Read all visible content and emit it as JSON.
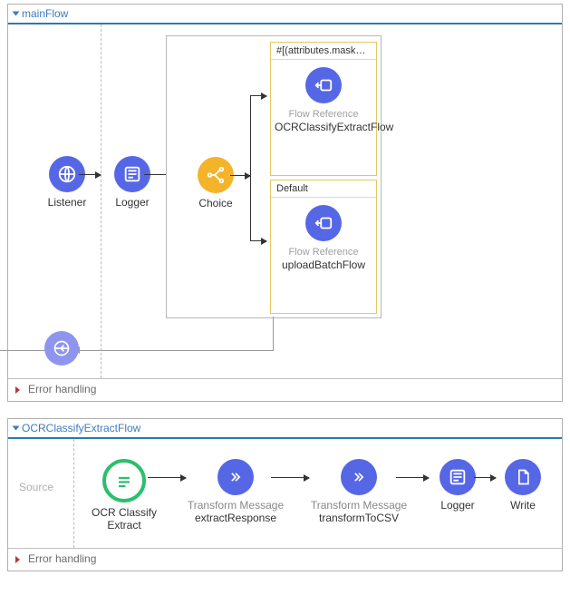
{
  "mainFlow": {
    "title": "mainFlow",
    "listener": "Listener",
    "logger": "Logger",
    "choice": "Choice",
    "routes": [
      {
        "condition": "#[(attributes.maskedRe...",
        "refLabel": "Flow Reference",
        "refName": "OCRClassifyExtractFlow"
      },
      {
        "condition": "Default",
        "refLabel": "Flow Reference",
        "refName": "uploadBatchFlow"
      }
    ],
    "error": "Error handling"
  },
  "flow2": {
    "title": "OCRClassifyExtractFlow",
    "sourceLabel": "Source",
    "nodes": {
      "ocr": {
        "top": "",
        "name": "OCR Classify Extract"
      },
      "t1": {
        "top": "Transform Message",
        "name": "extractResponse"
      },
      "t2": {
        "top": "Transform Message",
        "name": "transformToCSV"
      },
      "logger": {
        "top": "",
        "name": "Logger"
      },
      "write": {
        "top": "",
        "name": "Write"
      }
    },
    "error": "Error handling"
  },
  "colors": {
    "blue": "#5667e6",
    "amber": "#f3b42a",
    "green": "#2cbf6d",
    "headerRule": "#2a7ab0"
  }
}
